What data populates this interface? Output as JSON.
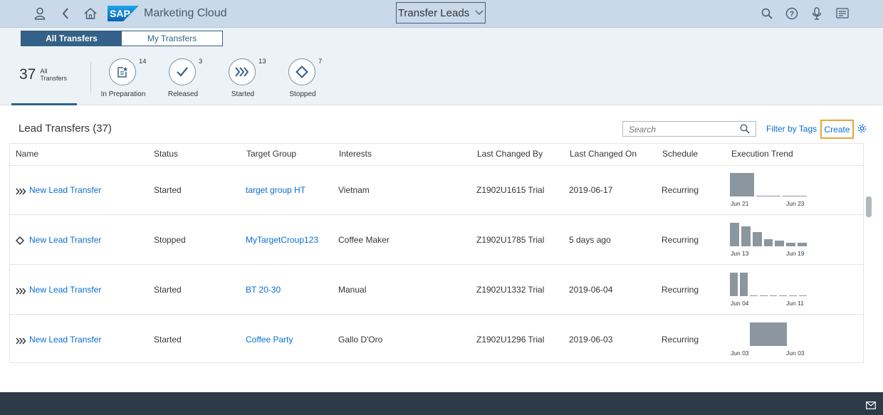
{
  "shell": {
    "app_title": "Marketing Cloud",
    "center_title": "Transfer Leads",
    "icons": [
      "user-icon",
      "back-icon",
      "home-icon",
      "search-icon",
      "help-icon",
      "microphone-icon",
      "notifications-icon"
    ]
  },
  "header": {
    "segments": [
      "All Transfers",
      "My Transfers"
    ],
    "total_count": "37",
    "total_label_line1": "All",
    "total_label_line2": "Transfers",
    "filters": [
      {
        "name": "In Preparation",
        "count": "14",
        "icon": "document-edit-icon"
      },
      {
        "name": "Released",
        "count": "3",
        "icon": "checkmark-icon"
      },
      {
        "name": "Started",
        "count": "13",
        "icon": "fast-forward-icon"
      },
      {
        "name": "Stopped",
        "count": "7",
        "icon": "diamond-icon"
      }
    ]
  },
  "table": {
    "title": "Lead Transfers (37)",
    "search_placeholder": "Search",
    "filter_by_tags": "Filter by Tags",
    "create": "Create",
    "columns": [
      "Name",
      "Status",
      "Target Group",
      "Interests",
      "Last Changed By",
      "Last Changed On",
      "Schedule",
      "Execution Trend"
    ],
    "rows": [
      {
        "status_icon": "fast-forward-icon",
        "name": "New Lead Transfer",
        "status": "Started",
        "target_group": "target group HT",
        "interests": "Vietnam",
        "changed_by": "Z1902U1615 Trial",
        "changed_on": "2019-06-17",
        "schedule": "Recurring",
        "trend": {
          "start": "Jun 21",
          "end": "Jun 23",
          "values": [
            1.0,
            0.03,
            0.03
          ]
        }
      },
      {
        "status_icon": "diamond-icon",
        "name": "New Lead Transfer",
        "status": "Stopped",
        "target_group": "MyTargetCroup123",
        "interests": "Coffee Maker",
        "changed_by": "Z1902U1785 Trial",
        "changed_on": "5 days ago",
        "schedule": "Recurring",
        "trend": {
          "start": "Jun 13",
          "end": "Jun 19",
          "values": [
            1.0,
            0.85,
            0.6,
            0.3,
            0.25,
            0.15,
            0.15
          ]
        }
      },
      {
        "status_icon": "fast-forward-icon",
        "name": "New Lead Transfer",
        "status": "Started",
        "target_group": "BT 20-30",
        "interests": "Manual",
        "changed_by": "Z1902U1332 Trial",
        "changed_on": "2019-06-04",
        "schedule": "Recurring",
        "trend": {
          "start": "Jun 04",
          "end": "Jun 11",
          "values": [
            1.0,
            1.0,
            0.03,
            0.03,
            0.03,
            0.03,
            0.03,
            0.03
          ]
        }
      },
      {
        "status_icon": "fast-forward-icon",
        "name": "New Lead Transfer",
        "status": "Started",
        "target_group": "Coffee Party",
        "interests": "Gallo D'Oro",
        "changed_by": "Z1902U1296 Trial",
        "changed_on": "2019-06-03",
        "schedule": "Recurring",
        "trend": {
          "start": "Jun 03",
          "end": "Jun 03",
          "values": [
            1.0
          ]
        }
      }
    ]
  },
  "footer": {
    "icon": "mail-icon"
  },
  "colors": {
    "link": "#0a6ed1",
    "brand": "#346187",
    "shell": "#c9d9ea",
    "highlight": "#e8a43a",
    "bar": "#8c969f"
  }
}
